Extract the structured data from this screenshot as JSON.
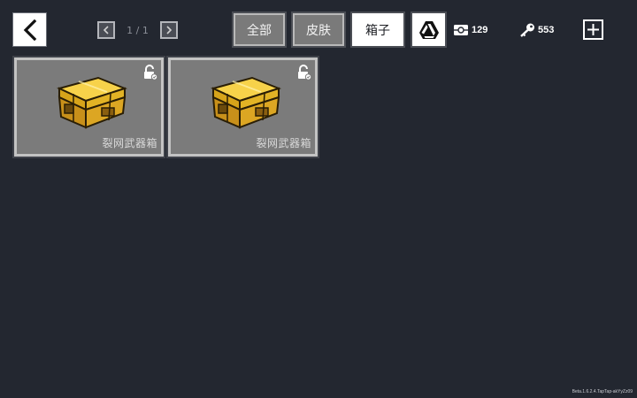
{
  "header": {
    "pager": {
      "text": "1 / 1"
    },
    "tabs": [
      {
        "label": "全部",
        "active": false
      },
      {
        "label": "皮肤",
        "active": false
      },
      {
        "label": "箱子",
        "active": true
      }
    ],
    "currencies": [
      {
        "icon": "ticket-icon",
        "value": "129"
      },
      {
        "icon": "key-icon",
        "value": "553"
      }
    ]
  },
  "items": [
    {
      "name": "裂网武器箱",
      "icon": "gold-chest-icon",
      "locked": true
    },
    {
      "name": "裂网武器箱",
      "icon": "gold-chest-icon",
      "locked": true
    }
  ],
  "footer": {
    "version": "Beta.1.6.2.4.TapTap-akYyZz09"
  },
  "colors": {
    "background": "#232730",
    "card": "#7b7b7b",
    "chest_gold": "#e8b820"
  }
}
